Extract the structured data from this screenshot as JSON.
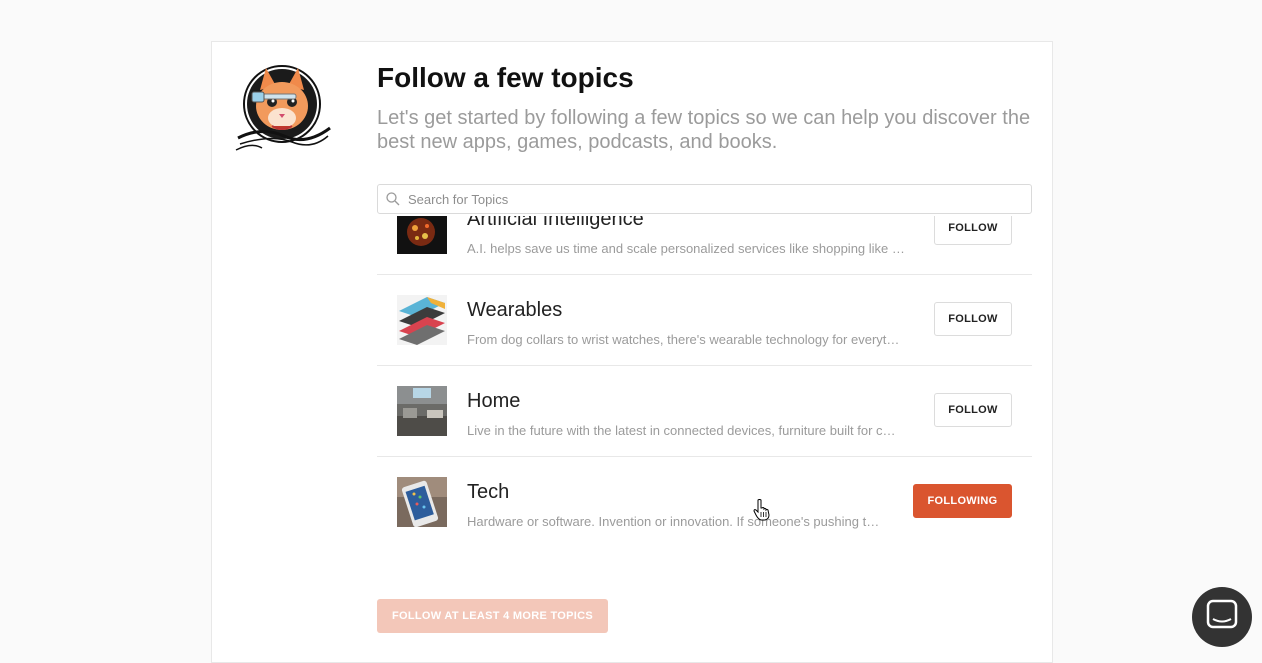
{
  "onboarding": {
    "title": "Follow a few topics",
    "subtitle": "Let's get started by following a few topics so we can help you discover the best new apps, games, podcasts, and books."
  },
  "search": {
    "placeholder": "Search for Topics",
    "icon": "search-icon"
  },
  "topics": [
    {
      "name": "Artificial Intelligence",
      "description": "A.I. helps save us time and scale personalized services like shopping like …",
      "button": "FOLLOW",
      "following": false
    },
    {
      "name": "Wearables",
      "description": "From dog collars to wrist watches, there's wearable technology for everyt…",
      "button": "FOLLOW",
      "following": false
    },
    {
      "name": "Home",
      "description": "Live in the future with the latest in connected devices, furniture built for c…",
      "button": "FOLLOW",
      "following": false
    },
    {
      "name": "Tech",
      "description": "Hardware or software. Invention or innovation. If someone's pushing t…",
      "button": "FOLLOWING",
      "following": true
    }
  ],
  "cta": {
    "label": "FOLLOW AT LEAST 4 MORE TOPICS"
  },
  "colors": {
    "accent": "#da552f",
    "accent_disabled": "#f3c7b9"
  }
}
